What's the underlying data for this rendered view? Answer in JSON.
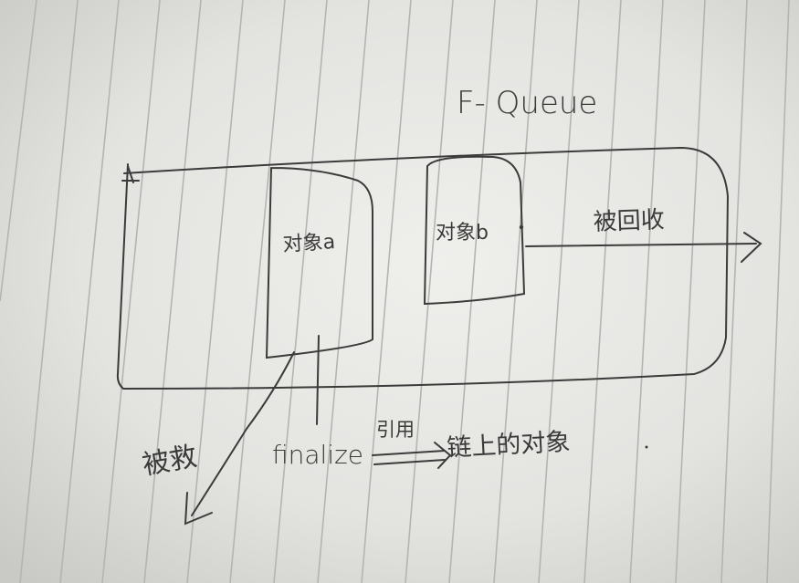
{
  "notes": {
    "queue_title": "F- Queue",
    "object_a": "对象a",
    "object_b": "对象b",
    "recycled": "被回收",
    "rescued": "被救",
    "finalize": "finalize",
    "reference": "引用",
    "chain_objects": "链上的对象"
  }
}
